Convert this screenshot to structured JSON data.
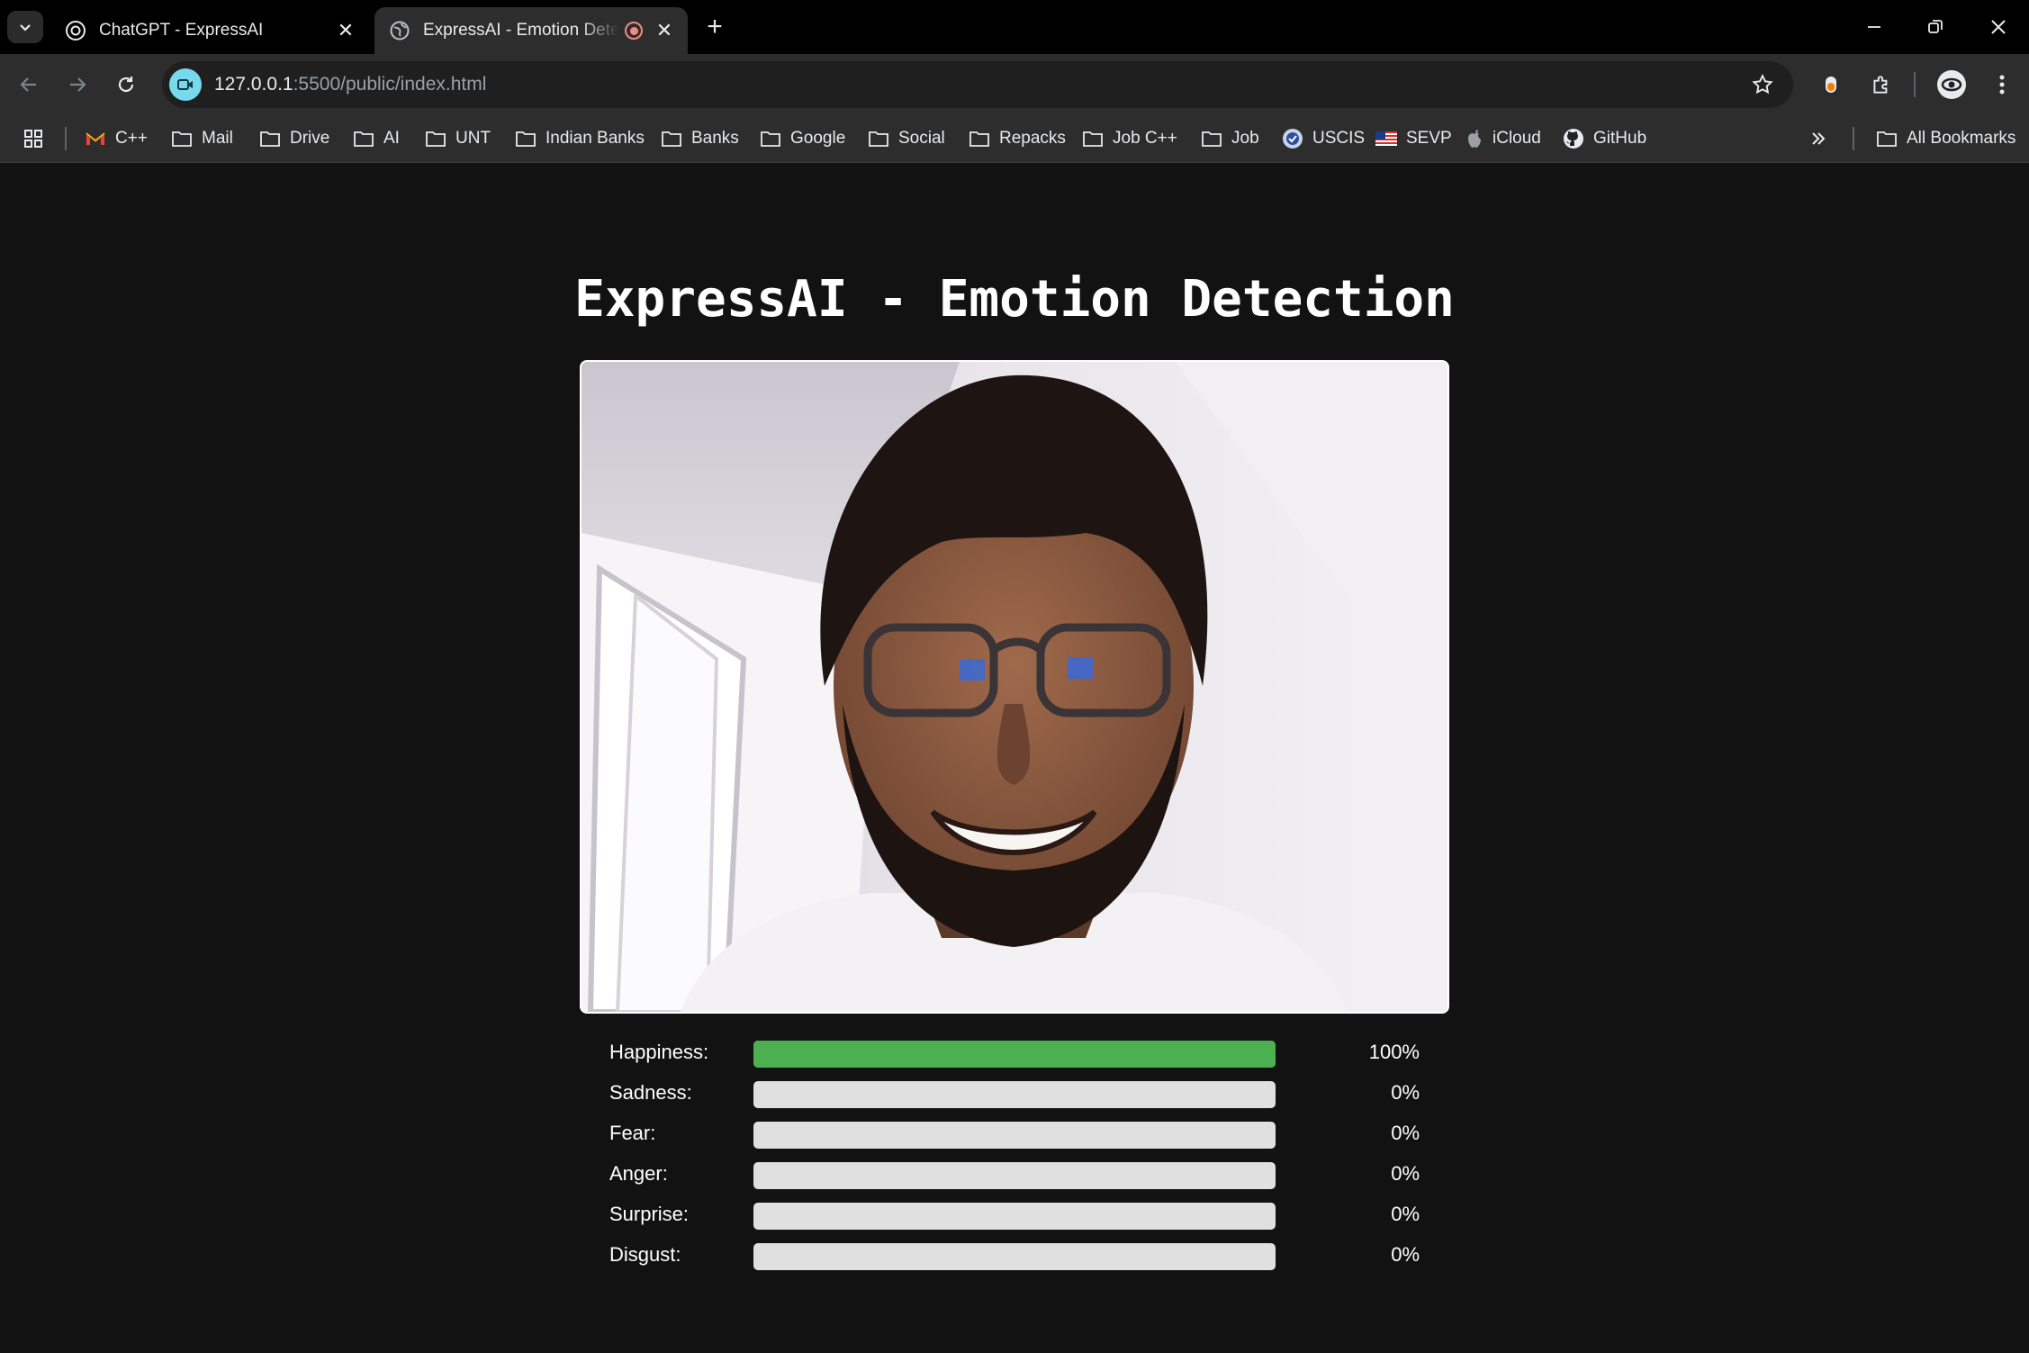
{
  "browser": {
    "tabs": [
      {
        "title": "ChatGPT - ExpressAI",
        "icon": "openai-icon",
        "active": false
      },
      {
        "title": "ExpressAI - Emotion Detection",
        "icon": "globe-icon",
        "active": true,
        "recording": true
      }
    ],
    "url": {
      "host": "127.0.0.1",
      "path": ":5500/public/index.html"
    },
    "bookmarks": [
      {
        "label": "C++",
        "icon": "gmail-icon"
      },
      {
        "label": "Mail",
        "icon": "folder-icon"
      },
      {
        "label": "Drive",
        "icon": "folder-icon"
      },
      {
        "label": "AI",
        "icon": "folder-icon"
      },
      {
        "label": "UNT",
        "icon": "folder-icon"
      },
      {
        "label": "Indian Banks",
        "icon": "folder-icon"
      },
      {
        "label": "Banks",
        "icon": "folder-icon"
      },
      {
        "label": "Google",
        "icon": "folder-icon"
      },
      {
        "label": "Social",
        "icon": "folder-icon"
      },
      {
        "label": "Repacks",
        "icon": "folder-icon"
      },
      {
        "label": "Job C++",
        "icon": "folder-icon"
      },
      {
        "label": "Job",
        "icon": "folder-icon"
      },
      {
        "label": "USCIS",
        "icon": "uscis-seal-icon"
      },
      {
        "label": "SEVP",
        "icon": "us-flag-icon"
      },
      {
        "label": "iCloud",
        "icon": "apple-icon"
      },
      {
        "label": "GitHub",
        "icon": "github-icon"
      }
    ],
    "all_bookmarks": "All Bookmarks"
  },
  "page": {
    "title": "ExpressAI - Emotion Detection",
    "emotions": [
      {
        "label": "Happiness:",
        "value": 1.0,
        "display": "100%"
      },
      {
        "label": "Sadness:",
        "value": 0.0,
        "display": "0%"
      },
      {
        "label": "Fear:",
        "value": 0.0,
        "display": "0%"
      },
      {
        "label": "Anger:",
        "value": 0.0,
        "display": "0%"
      },
      {
        "label": "Surprise:",
        "value": 0.0,
        "display": "0%"
      },
      {
        "label": "Disgust:",
        "value": 0.0,
        "display": "0%"
      }
    ],
    "colors": {
      "bar_fill": "#4caf50",
      "bar_track": "#e0e0e0",
      "background": "#121212"
    }
  }
}
